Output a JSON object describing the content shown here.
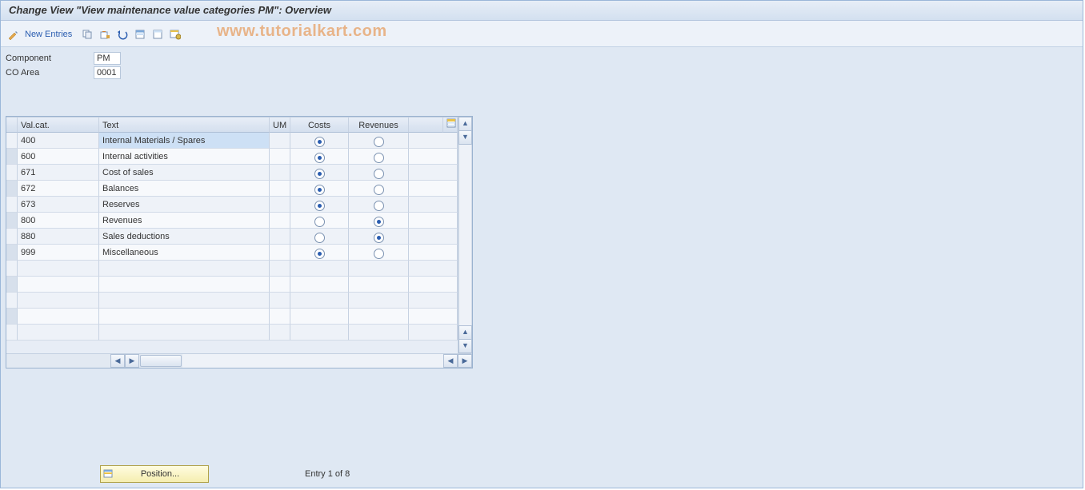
{
  "title": "Change View \"View maintenance value categories PM\": Overview",
  "watermark": "www.tutorialkart.com",
  "toolbar": {
    "new_entries_label": "New Entries"
  },
  "header": {
    "component_label": "Component",
    "component_value": "PM",
    "coarea_label": "CO Area",
    "coarea_value": "0001"
  },
  "columns": {
    "valcat": "Val.cat.",
    "text": "Text",
    "um": "UM",
    "costs": "Costs",
    "revenues": "Revenues"
  },
  "rows": [
    {
      "valcat": "400",
      "text": "Internal Materials / Spares",
      "um": "",
      "costs": true,
      "revenues": false
    },
    {
      "valcat": "600",
      "text": "Internal activities",
      "um": "",
      "costs": true,
      "revenues": false
    },
    {
      "valcat": "671",
      "text": "Cost of sales",
      "um": "",
      "costs": true,
      "revenues": false
    },
    {
      "valcat": "672",
      "text": "Balances",
      "um": "",
      "costs": true,
      "revenues": false
    },
    {
      "valcat": "673",
      "text": "Reserves",
      "um": "",
      "costs": true,
      "revenues": false
    },
    {
      "valcat": "800",
      "text": "Revenues",
      "um": "",
      "costs": false,
      "revenues": true
    },
    {
      "valcat": "880",
      "text": "Sales deductions",
      "um": "",
      "costs": false,
      "revenues": true
    },
    {
      "valcat": "999",
      "text": "Miscellaneous",
      "um": "",
      "costs": true,
      "revenues": false
    }
  ],
  "empty_rows": 5,
  "footer": {
    "position_label": "Position...",
    "entry_status": "Entry 1 of 8"
  },
  "colors": {
    "accent": "#2a5db0",
    "panel_bg": "#dfe8f3"
  }
}
